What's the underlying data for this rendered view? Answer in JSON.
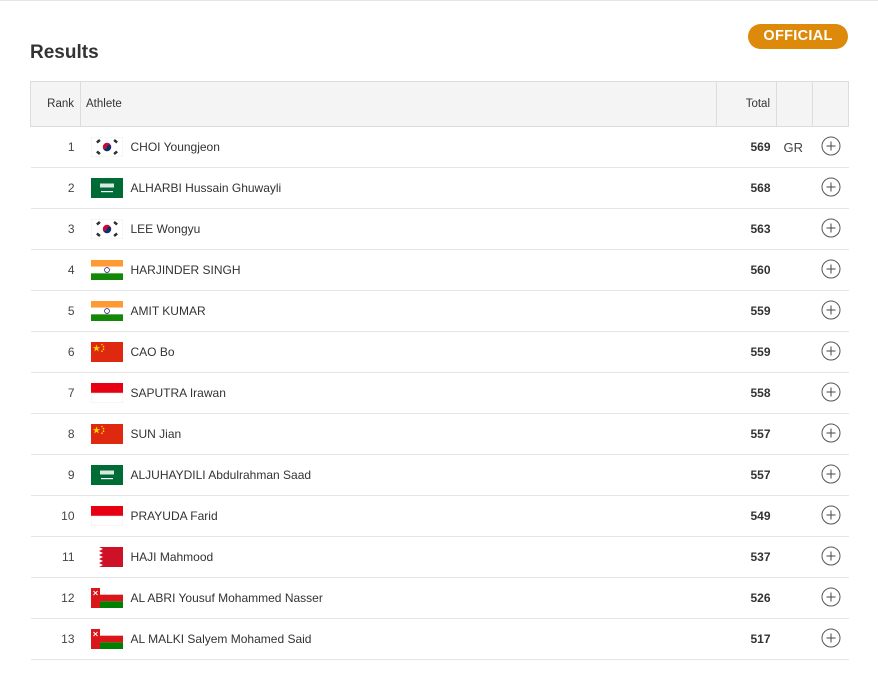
{
  "title": "Results",
  "badge": "OFFICIAL",
  "columns": {
    "rank": "Rank",
    "athlete": "Athlete",
    "total": "Total"
  },
  "rows": [
    {
      "rank": "1",
      "flag": "KOR",
      "name": "CHOI Youngjeon",
      "total": "569",
      "record": "GR"
    },
    {
      "rank": "2",
      "flag": "KSA",
      "name": "ALHARBI Hussain Ghuwayli",
      "total": "568",
      "record": ""
    },
    {
      "rank": "3",
      "flag": "KOR",
      "name": "LEE Wongyu",
      "total": "563",
      "record": ""
    },
    {
      "rank": "4",
      "flag": "IND",
      "name": "HARJINDER SINGH",
      "total": "560",
      "record": ""
    },
    {
      "rank": "5",
      "flag": "IND",
      "name": "AMIT KUMAR",
      "total": "559",
      "record": ""
    },
    {
      "rank": "6",
      "flag": "CHN",
      "name": "CAO Bo",
      "total": "559",
      "record": ""
    },
    {
      "rank": "7",
      "flag": "INA",
      "name": "SAPUTRA Irawan",
      "total": "558",
      "record": ""
    },
    {
      "rank": "8",
      "flag": "CHN",
      "name": "SUN Jian",
      "total": "557",
      "record": ""
    },
    {
      "rank": "9",
      "flag": "KSA",
      "name": "ALJUHAYDILI Abdulrahman Saad",
      "total": "557",
      "record": ""
    },
    {
      "rank": "10",
      "flag": "INA",
      "name": "PRAYUDA Farid",
      "total": "549",
      "record": ""
    },
    {
      "rank": "11",
      "flag": "BRN",
      "name": "HAJI Mahmood",
      "total": "537",
      "record": ""
    },
    {
      "rank": "12",
      "flag": "OMA",
      "name": "AL ABRI Yousuf Mohammed Nasser",
      "total": "526",
      "record": ""
    },
    {
      "rank": "13",
      "flag": "OMA",
      "name": "AL MALKI Salyem Mohamed Said",
      "total": "517",
      "record": ""
    }
  ],
  "colors": {
    "badge": "#dd8a0b",
    "header_bg": "#f4f4f4",
    "border": "#dcdcdc"
  }
}
